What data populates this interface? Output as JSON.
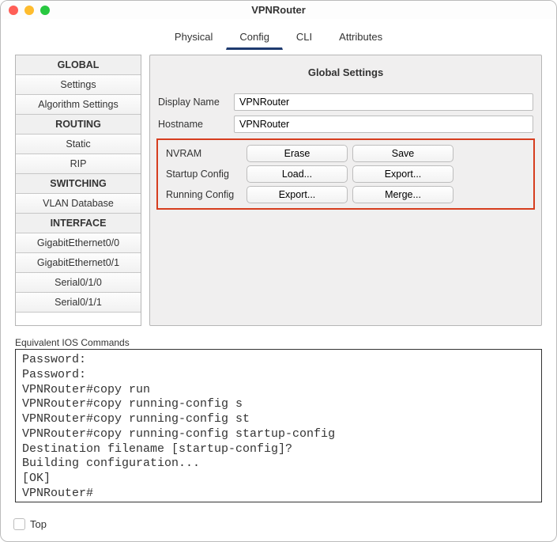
{
  "window": {
    "title": "VPNRouter"
  },
  "tabs": {
    "physical": "Physical",
    "config": "Config",
    "cli": "CLI",
    "attributes": "Attributes"
  },
  "sidebar": {
    "global": {
      "header": "GLOBAL",
      "settings": "Settings",
      "algo": "Algorithm Settings"
    },
    "routing": {
      "header": "ROUTING",
      "static": "Static",
      "rip": "RIP"
    },
    "switching": {
      "header": "SWITCHING",
      "vlan": "VLAN Database"
    },
    "interface": {
      "header": "INTERFACE",
      "ge00": "GigabitEthernet0/0",
      "ge01": "GigabitEthernet0/1",
      "s010": "Serial0/1/0",
      "s011": "Serial0/1/1"
    }
  },
  "panel": {
    "title": "Global Settings",
    "displayName_label": "Display Name",
    "displayName_value": "VPNRouter",
    "hostname_label": "Hostname",
    "hostname_value": "VPNRouter",
    "nvram": {
      "label": "NVRAM",
      "erase": "Erase",
      "save": "Save"
    },
    "startup": {
      "label": "Startup Config",
      "load": "Load...",
      "export": "Export..."
    },
    "running": {
      "label": "Running Config",
      "export": "Export...",
      "merge": "Merge..."
    }
  },
  "ios": {
    "label": "Equivalent IOS Commands",
    "output": "Password:\nPassword:\nVPNRouter#copy run\nVPNRouter#copy running-config s\nVPNRouter#copy running-config st\nVPNRouter#copy running-config startup-config\nDestination filename [startup-config]? \nBuilding configuration...\n[OK]\nVPNRouter#"
  },
  "footer": {
    "top": "Top"
  }
}
